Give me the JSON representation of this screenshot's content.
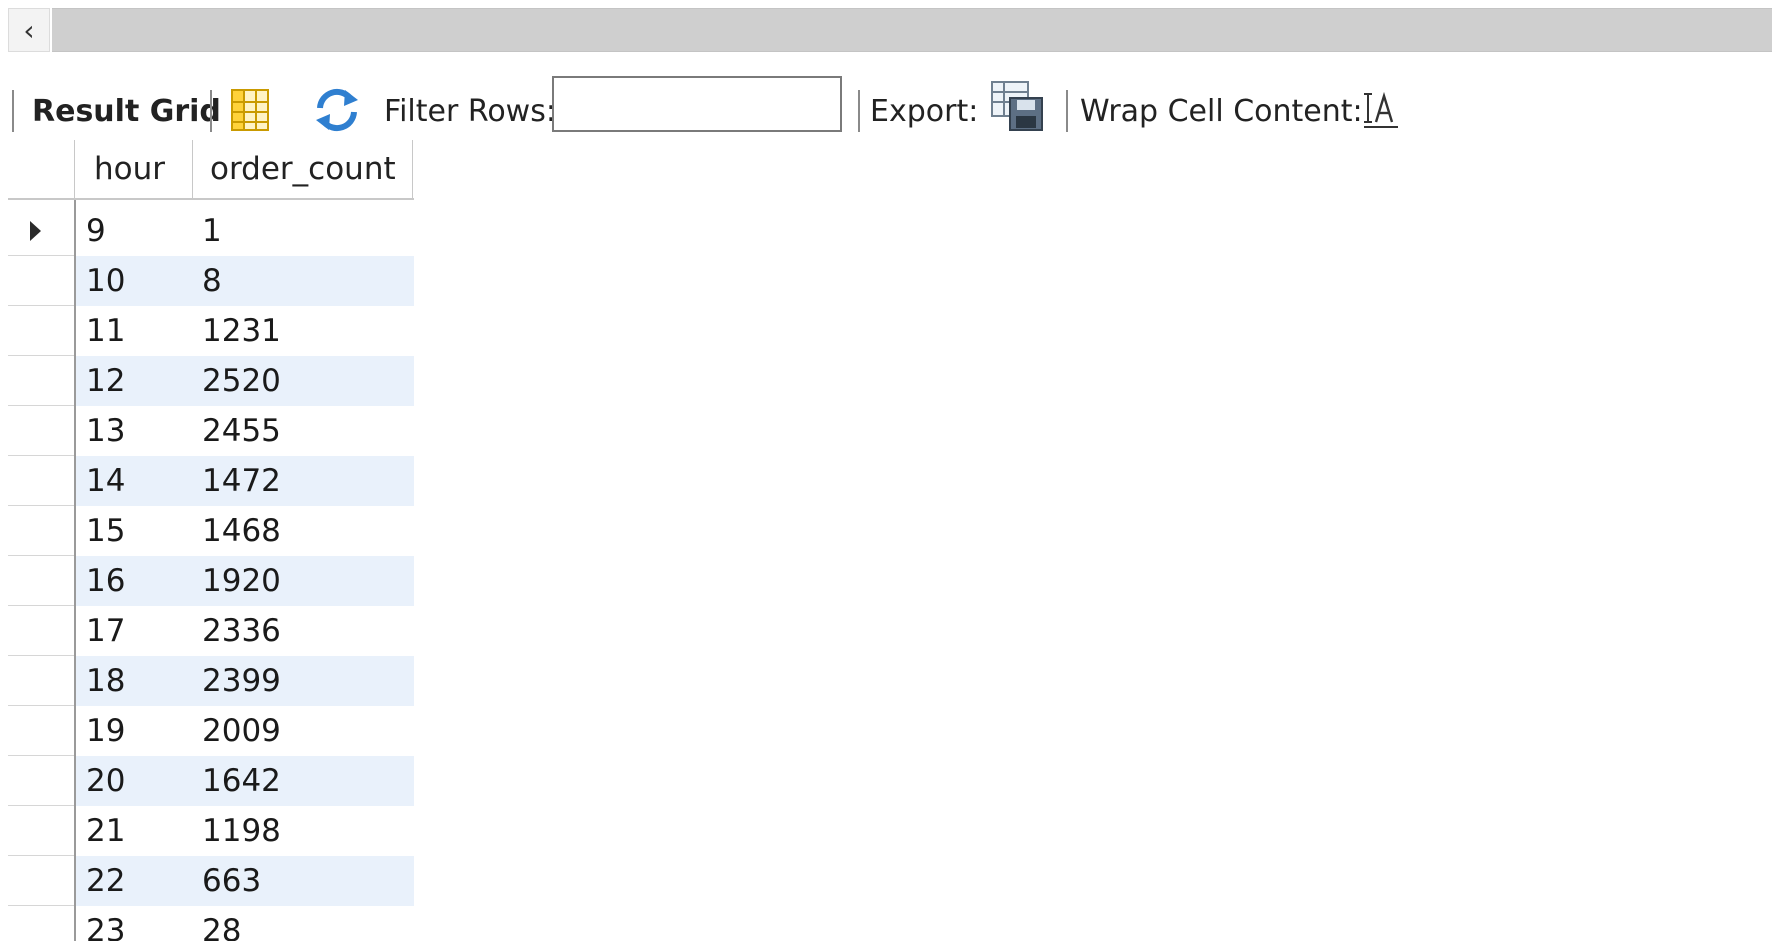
{
  "scroll": {
    "left_glyph": "‹"
  },
  "toolbar": {
    "result_grid_label": "Result Grid",
    "filter_rows_label": "Filter Rows:",
    "filter_rows_value": "",
    "export_label": "Export:",
    "wrap_label": "Wrap Cell Content:",
    "icons": {
      "grid": "grid-icon",
      "refresh": "refresh-icon",
      "export": "export-icon",
      "wrap": "wrap-cell-icon"
    },
    "accent_colors": {
      "grid_icon": "#e8b400",
      "refresh_icon": "#2f7fd0"
    }
  },
  "grid": {
    "columns": [
      "hour",
      "order_count"
    ],
    "rows": [
      {
        "hour": "9",
        "order_count": "1"
      },
      {
        "hour": "10",
        "order_count": "8"
      },
      {
        "hour": "11",
        "order_count": "1231"
      },
      {
        "hour": "12",
        "order_count": "2520"
      },
      {
        "hour": "13",
        "order_count": "2455"
      },
      {
        "hour": "14",
        "order_count": "1472"
      },
      {
        "hour": "15",
        "order_count": "1468"
      },
      {
        "hour": "16",
        "order_count": "1920"
      },
      {
        "hour": "17",
        "order_count": "2336"
      },
      {
        "hour": "18",
        "order_count": "2399"
      },
      {
        "hour": "19",
        "order_count": "2009"
      },
      {
        "hour": "20",
        "order_count": "1642"
      },
      {
        "hour": "21",
        "order_count": "1198"
      },
      {
        "hour": "22",
        "order_count": "663"
      },
      {
        "hour": "23",
        "order_count": "28"
      }
    ],
    "selected_row": 0,
    "alt_row_color": "#e9f1fb"
  }
}
